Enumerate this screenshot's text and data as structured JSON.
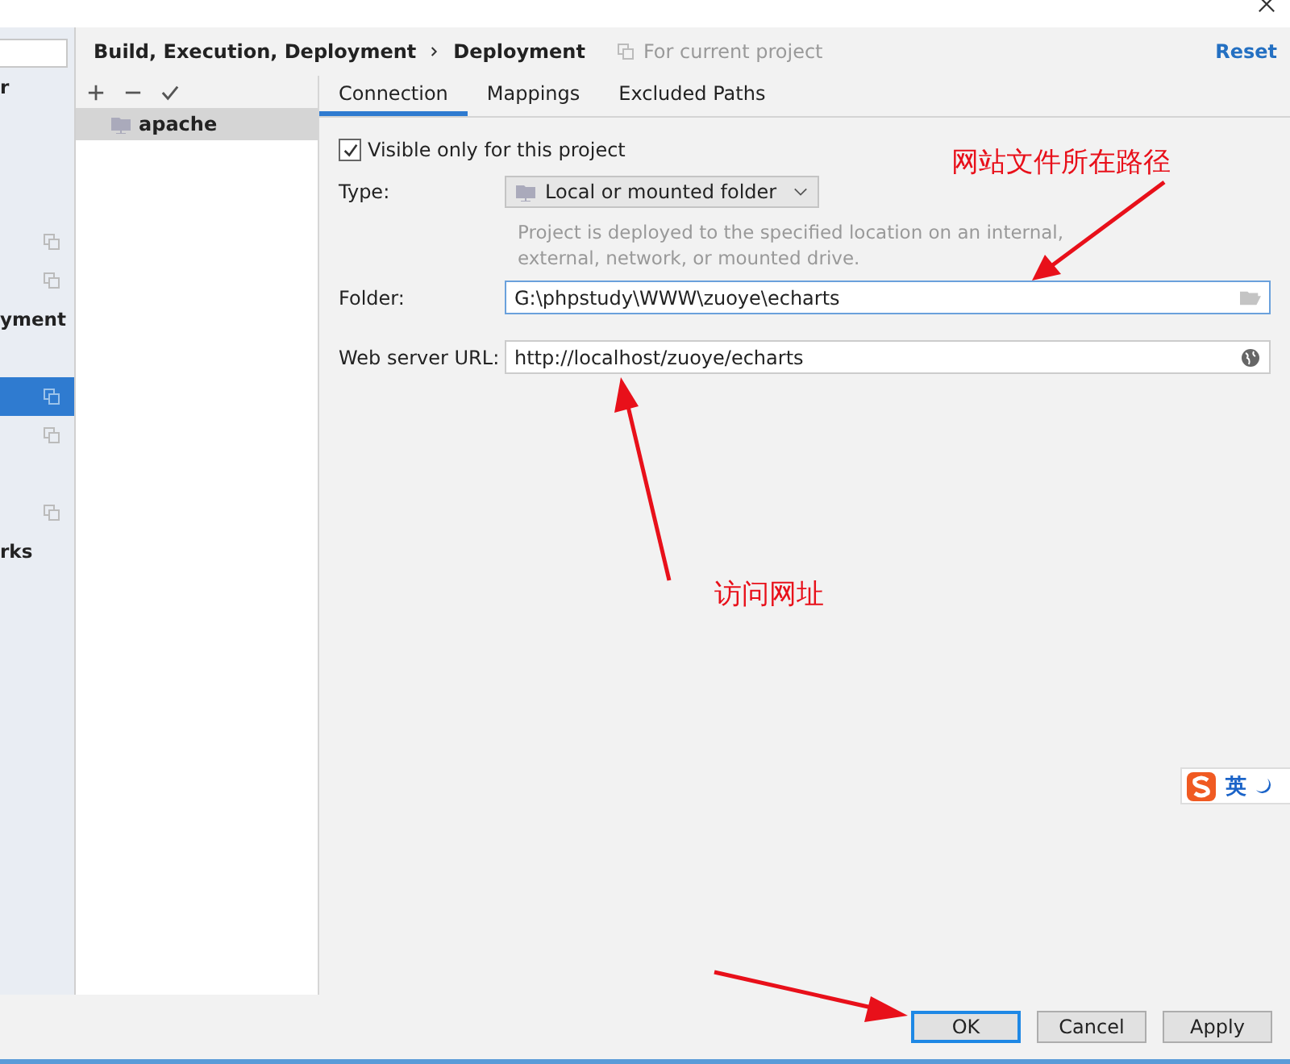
{
  "sidebar": {
    "items": [
      {
        "kind": "label",
        "label": "r",
        "selected": false
      },
      {
        "kind": "blank"
      },
      {
        "kind": "blank"
      },
      {
        "kind": "blank"
      },
      {
        "kind": "shared",
        "selected": false
      },
      {
        "kind": "shared",
        "selected": false
      },
      {
        "kind": "label",
        "label": "yment",
        "selected": false
      },
      {
        "kind": "blank"
      },
      {
        "kind": "shared",
        "selected": true
      },
      {
        "kind": "shared",
        "selected": false
      },
      {
        "kind": "blank"
      },
      {
        "kind": "shared",
        "selected": false
      },
      {
        "kind": "label",
        "label": "rks",
        "selected": false
      }
    ]
  },
  "breadcrumb": [
    "Build, Execution, Deployment",
    "Deployment"
  ],
  "scope_note": "For current project",
  "reset": "Reset",
  "servers": [
    {
      "name": "apache",
      "selected": true
    }
  ],
  "tabs": [
    {
      "label": "Connection",
      "selected": true
    },
    {
      "label": "Mappings",
      "selected": false
    },
    {
      "label": "Excluded Paths",
      "selected": false
    }
  ],
  "form": {
    "visible_only": {
      "label": "Visible only for this project",
      "checked": true
    },
    "type": {
      "label": "Type:",
      "value": "Local or mounted folder"
    },
    "description": "Project is deployed to the specified location on an internal, external, network, or mounted drive.",
    "folder": {
      "label": "Folder:",
      "value": "G:\\phpstudy\\WWW\\zuoye\\echarts"
    },
    "url": {
      "label": "Web server URL:",
      "value": "http://localhost/zuoye/echarts"
    }
  },
  "annotations": [
    {
      "text": "网站文件所在路径"
    },
    {
      "text": "访问网址"
    }
  ],
  "ime": {
    "label": "英"
  },
  "buttons": [
    {
      "label": "OK",
      "selected": true
    },
    {
      "label": "Cancel",
      "selected": false
    },
    {
      "label": "Apply",
      "selected": false
    }
  ]
}
